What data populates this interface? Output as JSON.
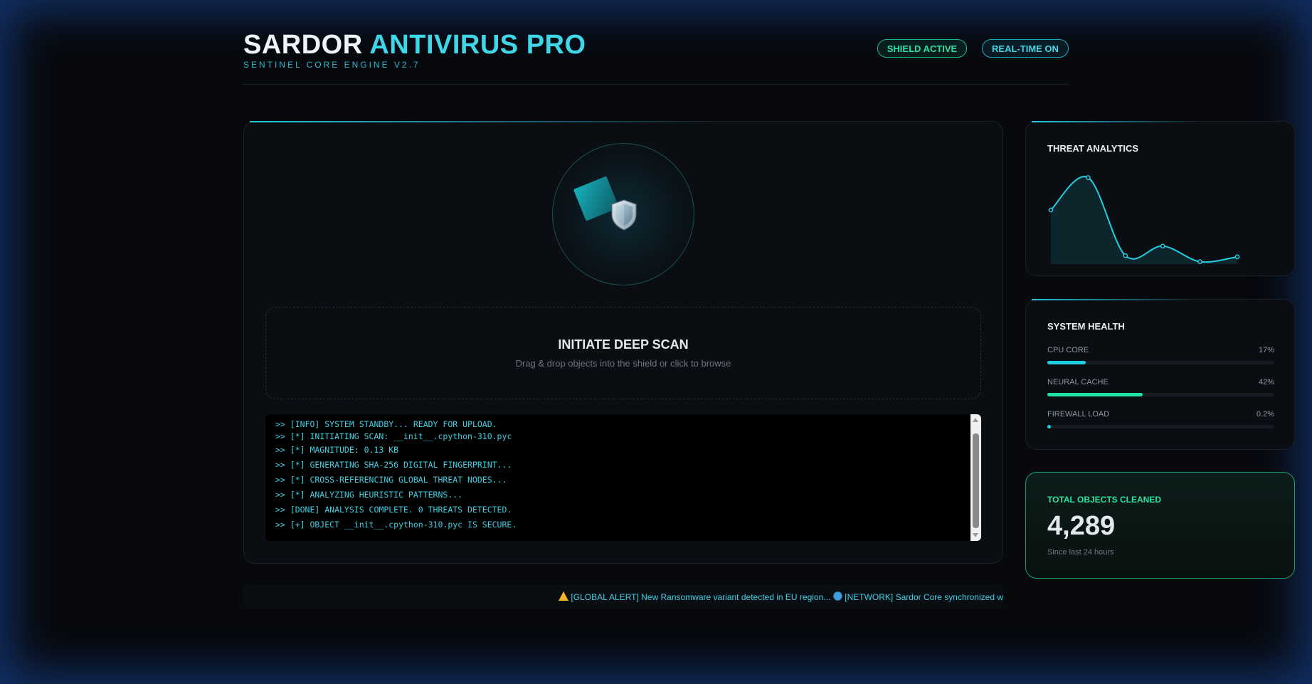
{
  "colors": {
    "accent": "#3fd6e8",
    "success": "#2ce0a4",
    "warning": "#f3b428",
    "panel": "#0a0d12"
  },
  "header": {
    "title_part1": "SARDOR",
    "title_part2": "ANTIVIRUS PRO",
    "subtitle": "SENTINEL CORE ENGINE V2.7",
    "badges": {
      "shield": "SHIELD ACTIVE",
      "realtime": "REAL-TIME ON"
    }
  },
  "scanner": {
    "icons": {
      "scan": "scan-wedge-icon",
      "shield": "shield-icon"
    },
    "dropzone_title": "INITIATE DEEP SCAN",
    "dropzone_hint": "Drag & drop objects into the shield or click to browse"
  },
  "console": {
    "lines": [
      ">> [INFO] SYSTEM STANDBY... READY FOR UPLOAD.",
      ">> [*] INITIATING SCAN: __init__.cpython-310.pyc",
      ">> [*] MAGNITUDE: 0.13 KB",
      ">> [*] GENERATING SHA-256 DIGITAL FINGERPRINT...",
      ">> [*] CROSS-REFERENCING GLOBAL THREAT NODES...",
      ">> [*] ANALYZING HEURISTIC PATTERNS...",
      ">> [DONE] ANALYSIS COMPLETE. 0 THREATS DETECTED.",
      ">> [+] OBJECT __init__.cpython-310.pyc IS SECURE."
    ]
  },
  "ticker": {
    "alert": "[GLOBAL ALERT] New Ransomware variant detected in EU region...",
    "network": "[NETWORK] Sardor Core synchronized w"
  },
  "threat_analytics": {
    "title": "THREAT ANALYTICS",
    "chart_data": {
      "type": "area",
      "values": [
        45,
        72,
        7,
        15,
        2,
        6
      ],
      "ylim": [
        0,
        80
      ]
    }
  },
  "system_health": {
    "title": "SYSTEM HEALTH",
    "metrics": [
      {
        "label": "CPU CORE",
        "value": "17%",
        "fraction": 0.17,
        "color": "#1fd1e0"
      },
      {
        "label": "NEURAL CACHE",
        "value": "42%",
        "fraction": 0.42,
        "color": "#22e0a6"
      },
      {
        "label": "FIREWALL LOAD",
        "value": "0.2%",
        "fraction": 0.002,
        "color": "#1fd1e0"
      }
    ]
  },
  "cleaned": {
    "title": "TOTAL OBJECTS CLEANED",
    "value": "4,289",
    "subtitle": "Since last 24 hours"
  }
}
